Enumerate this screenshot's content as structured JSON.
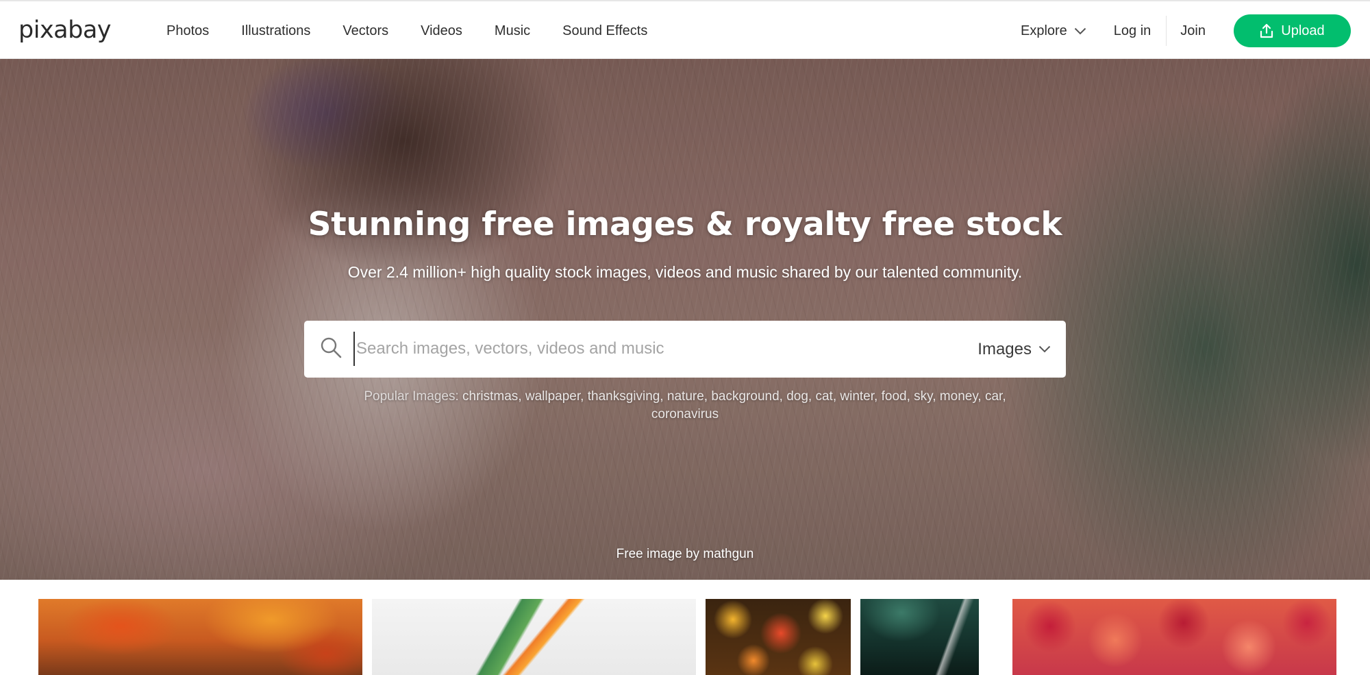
{
  "brand": {
    "logo_text": "pixabay"
  },
  "nav": {
    "links": [
      "Photos",
      "Illustrations",
      "Vectors",
      "Videos",
      "Music",
      "Sound Effects"
    ],
    "explore_label": "Explore",
    "login_label": "Log in",
    "join_label": "Join",
    "upload_label": "Upload",
    "upload_color": "#02be6e"
  },
  "hero": {
    "title": "Stunning free images & royalty free stock",
    "subtitle": "Over 2.4 million+ high quality stock images, videos and music shared by our talented community.",
    "search": {
      "placeholder": "Search images, vectors, videos and music",
      "value": "",
      "type_selected": "Images"
    },
    "popular_label": "Popular Images:",
    "popular_tags": [
      "christmas",
      "wallpaper",
      "thanksgiving",
      "nature",
      "background",
      "dog",
      "cat",
      "winter",
      "food",
      "sky",
      "money",
      "car",
      "coronavirus"
    ],
    "credit": "Free image by mathgun"
  },
  "icons": {
    "search": "search-icon",
    "chevron": "chevron-down-icon",
    "upload": "upload-icon"
  }
}
